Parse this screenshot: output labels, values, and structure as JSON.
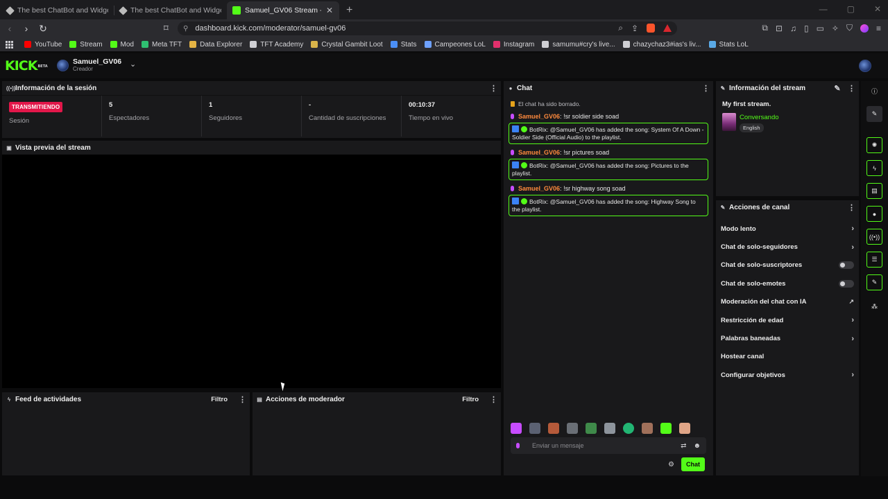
{
  "browser": {
    "tabs": [
      {
        "title": "The best ChatBot and Widgets for Ki",
        "active": false
      },
      {
        "title": "The best ChatBot and Widgets fo",
        "active": false
      },
      {
        "title": "Samuel_GV06 Stream - Kick Das",
        "active": true
      }
    ],
    "url": "dashboard.kick.com/moderator/samuel-gv06",
    "bookmarks": [
      {
        "label": "YouTube",
        "color": "#ff0000"
      },
      {
        "label": "Stream",
        "color": "#53fc18"
      },
      {
        "label": "Mod",
        "color": "#53fc18"
      },
      {
        "label": "Meta TFT",
        "color": "#2fbf71"
      },
      {
        "label": "Data Explorer",
        "color": "#e4b344"
      },
      {
        "label": "TFT Academy",
        "color": "#cfcfd3"
      },
      {
        "label": "Crystal Gambit Loot",
        "color": "#d9b44a"
      },
      {
        "label": "Stats",
        "color": "#4b8ff7"
      },
      {
        "label": "Campeones LoL",
        "color": "#6ea1ff"
      },
      {
        "label": "Instagram",
        "color": "#e1306c"
      },
      {
        "label": "samumu#cry's live...",
        "color": "#cfcfd3"
      },
      {
        "label": "chazychaz3#ias's liv...",
        "color": "#cfcfd3"
      },
      {
        "label": "Stats  LoL",
        "color": "#5aa9e6"
      }
    ]
  },
  "header": {
    "logo": "KICK",
    "logo_badge": "BETA",
    "channel_name": "Samuel_GV06",
    "channel_role": "Creador"
  },
  "session": {
    "title": "Información de la sesión",
    "live_badge": "TRANSMITIENDO",
    "stats": [
      {
        "value": "",
        "label": "Sesión"
      },
      {
        "value": "5",
        "label": "Espectadores"
      },
      {
        "value": "1",
        "label": "Seguidores"
      },
      {
        "value": "-",
        "label": "Cantidad de suscripciones"
      },
      {
        "value": "00:10:37",
        "label": "Tiempo en vivo"
      }
    ]
  },
  "preview": {
    "title": "Vista previa del stream"
  },
  "activity": {
    "title": "Feed de actividades",
    "filter": "Filtro"
  },
  "mod_actions": {
    "title": "Acciones de moderador",
    "filter": "Filtro"
  },
  "chat": {
    "title": "Chat",
    "system": "El chat ha sido borrado.",
    "messages": [
      {
        "type": "user",
        "user": "Samuel_GV06",
        "text": " !sr soldier side soad"
      },
      {
        "type": "bot",
        "user": "BotRix",
        "text": " @Samuel_GV06 has added the song: System Of A Down - Soldier Side (Official Audio) to the playlist."
      },
      {
        "type": "user",
        "user": "Samuel_GV06",
        "text": " !sr pictures soad"
      },
      {
        "type": "bot",
        "user": "BotRix",
        "text": " @Samuel_GV06 has added the song: Pictures to the playlist."
      },
      {
        "type": "user",
        "user": "Samuel_GV06",
        "text": " !sr highway song soad"
      },
      {
        "type": "bot",
        "user": "BotRix",
        "text": " @Samuel_GV06 has added the song: Highway Song to the playlist."
      }
    ],
    "input_placeholder": "Enviar un mensaje",
    "send_label": "Chat"
  },
  "stream_info": {
    "title": "Información del stream",
    "stream_title": "My first stream.",
    "category": "Conversando",
    "language": "English"
  },
  "channel_actions": {
    "title": "Acciones de canal",
    "items": [
      {
        "label": "Modo lento",
        "control": "arrow"
      },
      {
        "label": "Chat de solo-seguidores",
        "control": "arrow"
      },
      {
        "label": "Chat de solo-suscriptores",
        "control": "toggle"
      },
      {
        "label": "Chat de solo-emotes",
        "control": "toggle"
      },
      {
        "label": "Moderación del chat con IA",
        "control": "external"
      },
      {
        "label": "Restricción de edad",
        "control": "arrow"
      },
      {
        "label": "Palabras baneadas",
        "control": "arrow"
      },
      {
        "label": "Hostear canal",
        "control": "none"
      },
      {
        "label": "Configurar objetivos",
        "control": "arrow"
      }
    ]
  },
  "colors": {
    "accent": "#53fc18",
    "live": "#e2174a",
    "username": "#ff8a3d"
  }
}
